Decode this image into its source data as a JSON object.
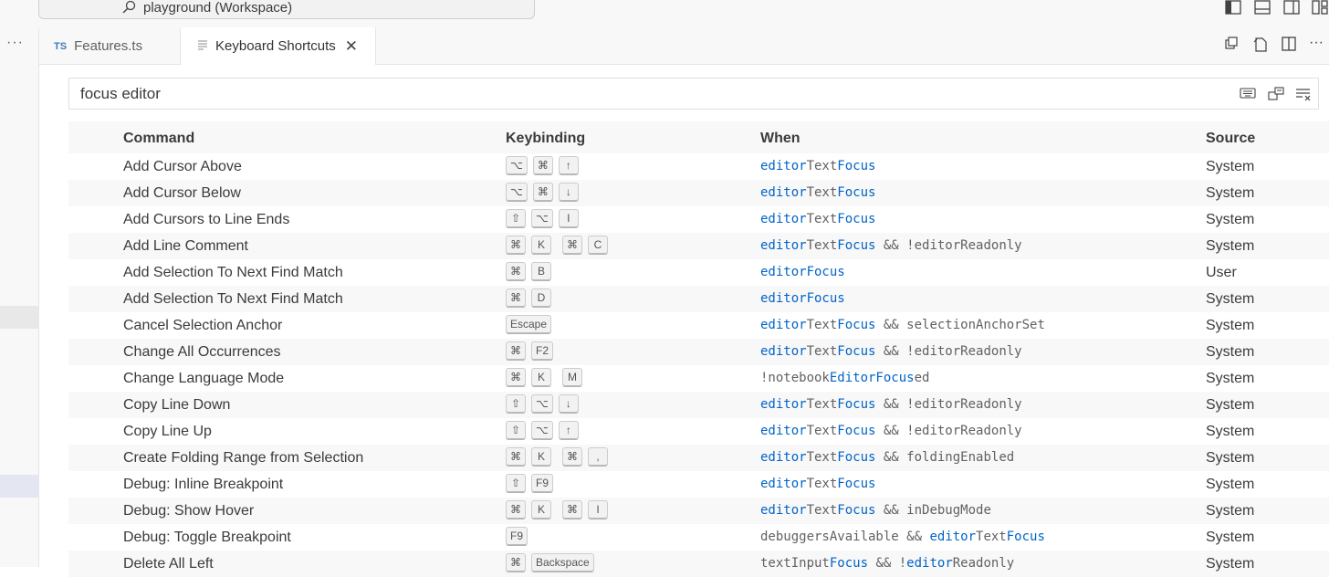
{
  "window": {
    "title": "playground (Workspace)"
  },
  "sidebar": {
    "more_label": "···"
  },
  "tabs": [
    {
      "label": "Features.ts",
      "badge": "TS",
      "active": false
    },
    {
      "label": "Keyboard Shortcuts",
      "active": true
    }
  ],
  "editor_actions_more": "···",
  "search": {
    "value": "focus editor"
  },
  "table": {
    "headers": {
      "command": "Command",
      "keybinding": "Keybinding",
      "when": "When",
      "source": "Source"
    },
    "rows": [
      {
        "command": "Add Cursor Above",
        "keys": [
          [
            "⌥",
            "⌘",
            "↑"
          ]
        ],
        "when": [
          [
            "editor",
            true
          ],
          [
            "Text",
            false
          ],
          [
            "Focus",
            true
          ]
        ],
        "source": "System"
      },
      {
        "command": "Add Cursor Below",
        "keys": [
          [
            "⌥",
            "⌘",
            "↓"
          ]
        ],
        "when": [
          [
            "editor",
            true
          ],
          [
            "Text",
            false
          ],
          [
            "Focus",
            true
          ]
        ],
        "source": "System"
      },
      {
        "command": "Add Cursors to Line Ends",
        "keys": [
          [
            "⇧",
            "⌥",
            "I"
          ]
        ],
        "when": [
          [
            "editor",
            true
          ],
          [
            "Text",
            false
          ],
          [
            "Focus",
            true
          ]
        ],
        "source": "System"
      },
      {
        "command": "Add Line Comment",
        "keys": [
          [
            "⌘",
            "K"
          ],
          [
            "⌘",
            "C"
          ]
        ],
        "when": [
          [
            "editor",
            true
          ],
          [
            "Text",
            false
          ],
          [
            "Focus",
            true
          ],
          [
            " && !editorReadonly",
            false
          ]
        ],
        "source": "System"
      },
      {
        "command": "Add Selection To Next Find Match",
        "keys": [
          [
            "⌘",
            "B"
          ]
        ],
        "when": [
          [
            "editorFocus",
            true
          ]
        ],
        "source": "User"
      },
      {
        "command": "Add Selection To Next Find Match",
        "keys": [
          [
            "⌘",
            "D"
          ]
        ],
        "when": [
          [
            "editorFocus",
            true
          ]
        ],
        "source": "System"
      },
      {
        "command": "Cancel Selection Anchor",
        "keys": [
          [
            "Escape"
          ]
        ],
        "when": [
          [
            "editor",
            true
          ],
          [
            "Text",
            false
          ],
          [
            "Focus",
            true
          ],
          [
            " && selectionAnchorSet",
            false
          ]
        ],
        "source": "System"
      },
      {
        "command": "Change All Occurrences",
        "keys": [
          [
            "⌘",
            "F2"
          ]
        ],
        "when": [
          [
            "editor",
            true
          ],
          [
            "Text",
            false
          ],
          [
            "Focus",
            true
          ],
          [
            " && !editorReadonly",
            false
          ]
        ],
        "source": "System"
      },
      {
        "command": "Change Language Mode",
        "keys": [
          [
            "⌘",
            "K"
          ],
          [
            "M"
          ]
        ],
        "when": [
          [
            "!notebook",
            false
          ],
          [
            "EditorFocus",
            true
          ],
          [
            "ed",
            false
          ]
        ],
        "source": "System"
      },
      {
        "command": "Copy Line Down",
        "keys": [
          [
            "⇧",
            "⌥",
            "↓"
          ]
        ],
        "when": [
          [
            "editor",
            true
          ],
          [
            "Text",
            false
          ],
          [
            "Focus",
            true
          ],
          [
            " && !editorReadonly",
            false
          ]
        ],
        "source": "System"
      },
      {
        "command": "Copy Line Up",
        "keys": [
          [
            "⇧",
            "⌥",
            "↑"
          ]
        ],
        "when": [
          [
            "editor",
            true
          ],
          [
            "Text",
            false
          ],
          [
            "Focus",
            true
          ],
          [
            " && !editorReadonly",
            false
          ]
        ],
        "source": "System"
      },
      {
        "command": "Create Folding Range from Selection",
        "keys": [
          [
            "⌘",
            "K"
          ],
          [
            "⌘",
            ","
          ]
        ],
        "when": [
          [
            "editor",
            true
          ],
          [
            "Text",
            false
          ],
          [
            "Focus",
            true
          ],
          [
            " && foldingEnabled",
            false
          ]
        ],
        "source": "System"
      },
      {
        "command": "Debug: Inline Breakpoint",
        "keys": [
          [
            "⇧",
            "F9"
          ]
        ],
        "when": [
          [
            "editor",
            true
          ],
          [
            "Text",
            false
          ],
          [
            "Focus",
            true
          ]
        ],
        "source": "System"
      },
      {
        "command": "Debug: Show Hover",
        "keys": [
          [
            "⌘",
            "K"
          ],
          [
            "⌘",
            "I"
          ]
        ],
        "when": [
          [
            "editor",
            true
          ],
          [
            "Text",
            false
          ],
          [
            "Focus",
            true
          ],
          [
            " && inDebugMode",
            false
          ]
        ],
        "source": "System"
      },
      {
        "command": "Debug: Toggle Breakpoint",
        "keys": [
          [
            "F9"
          ]
        ],
        "when": [
          [
            "debuggersAvailable && ",
            false
          ],
          [
            "editor",
            true
          ],
          [
            "Text",
            false
          ],
          [
            "Focus",
            true
          ]
        ],
        "source": "System"
      },
      {
        "command": "Delete All Left",
        "keys": [
          [
            "⌘",
            "Backspace"
          ]
        ],
        "when": [
          [
            "textInput",
            false
          ],
          [
            "Focus",
            true
          ],
          [
            " && !",
            false
          ],
          [
            "editor",
            true
          ],
          [
            "Readonly",
            false
          ]
        ],
        "source": "System"
      }
    ]
  }
}
